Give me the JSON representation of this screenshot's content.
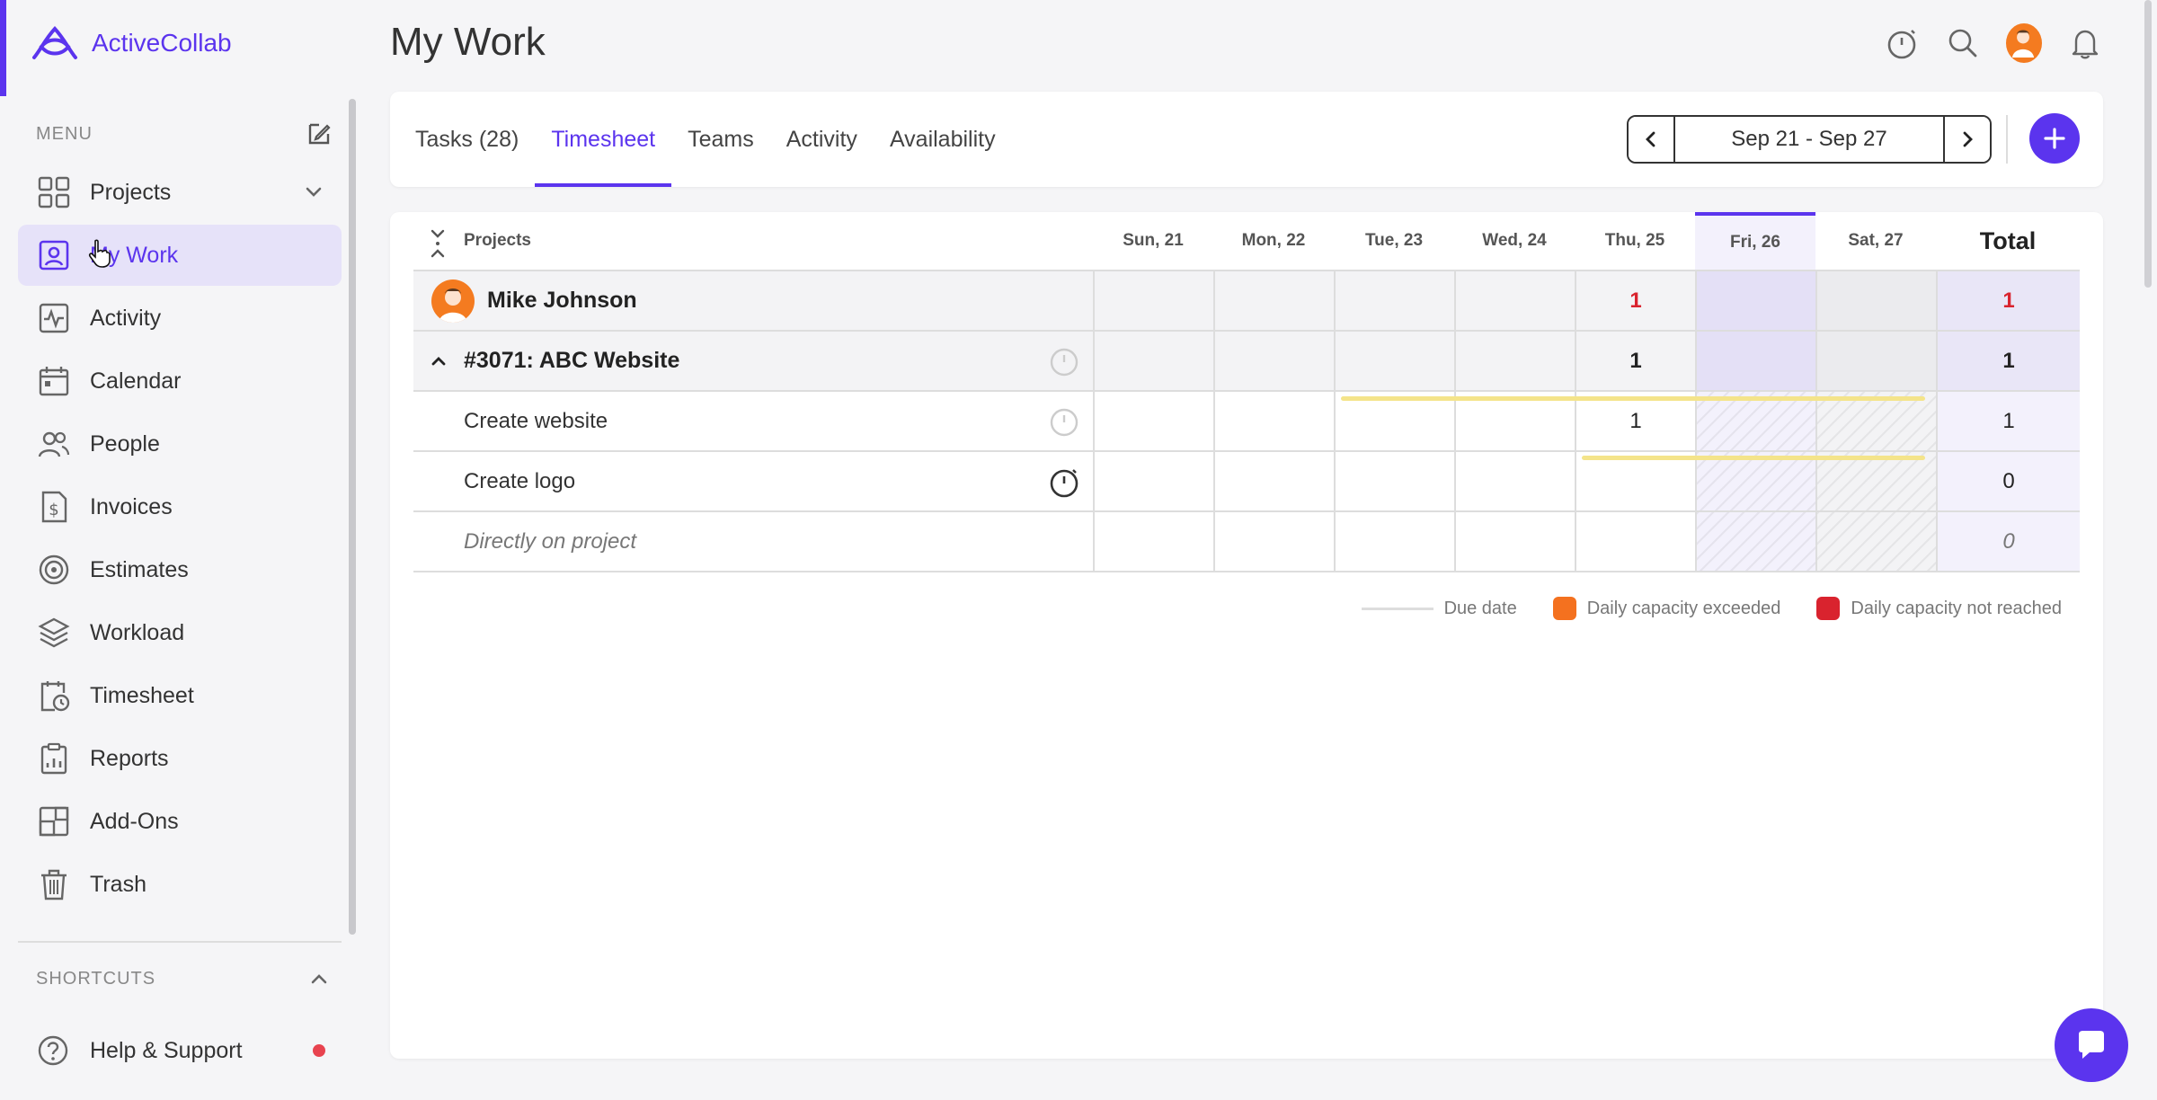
{
  "app": {
    "name": "ActiveCollab",
    "brand_color": "#5b34ee"
  },
  "page": {
    "title": "My Work"
  },
  "sidebar": {
    "menu_label": "MENU",
    "items": [
      {
        "label": "Projects",
        "icon": "grid-icon"
      },
      {
        "label": "My Work",
        "icon": "user-square-icon",
        "active": true
      },
      {
        "label": "Activity",
        "icon": "activity-icon"
      },
      {
        "label": "Calendar",
        "icon": "calendar-icon"
      },
      {
        "label": "People",
        "icon": "people-icon"
      },
      {
        "label": "Invoices",
        "icon": "invoice-icon"
      },
      {
        "label": "Estimates",
        "icon": "target-icon"
      },
      {
        "label": "Workload",
        "icon": "layers-icon"
      },
      {
        "label": "Timesheet",
        "icon": "timesheet-icon"
      },
      {
        "label": "Reports",
        "icon": "clipboard-icon"
      },
      {
        "label": "Add-Ons",
        "icon": "addons-icon"
      },
      {
        "label": "Trash",
        "icon": "trash-icon"
      }
    ],
    "shortcuts_label": "SHORTCUTS",
    "help_label": "Help & Support"
  },
  "tabs": [
    {
      "label": "Tasks (28)"
    },
    {
      "label": "Timesheet",
      "active": true
    },
    {
      "label": "Teams"
    },
    {
      "label": "Activity"
    },
    {
      "label": "Availability"
    }
  ],
  "date_range": "Sep 21 - Sep 27",
  "timesheet": {
    "name_header": "Projects",
    "days": [
      "Sun, 21",
      "Mon, 22",
      "Tue, 23",
      "Wed, 24",
      "Thu, 25",
      "Fri, 26",
      "Sat, 27"
    ],
    "total_header": "Total",
    "rows": [
      {
        "type": "user",
        "name": "Mike Johnson",
        "values": [
          "",
          "",
          "",
          "",
          "1",
          "",
          ""
        ],
        "total": "1"
      },
      {
        "type": "project",
        "name": "#3071: ABC Website",
        "values": [
          "",
          "",
          "",
          "",
          "1",
          "",
          ""
        ],
        "total": "1"
      },
      {
        "type": "task",
        "name": "Create website",
        "values": [
          "",
          "",
          "",
          "",
          "1",
          "",
          ""
        ],
        "total": "1"
      },
      {
        "type": "task",
        "name": "Create logo",
        "values": [
          "",
          "",
          "",
          "",
          "",
          "",
          ""
        ],
        "total": "0"
      },
      {
        "type": "direct",
        "name": "Directly on project",
        "values": [
          "",
          "",
          "",
          "",
          "",
          "",
          ""
        ],
        "total": "0"
      }
    ]
  },
  "legend": [
    {
      "label": "Due date",
      "kind": "line",
      "color": "#dddddd"
    },
    {
      "label": "Daily capacity exceeded",
      "kind": "square",
      "color": "#f4711f"
    },
    {
      "label": "Daily capacity not reached",
      "kind": "square",
      "color": "#d9232e"
    }
  ]
}
